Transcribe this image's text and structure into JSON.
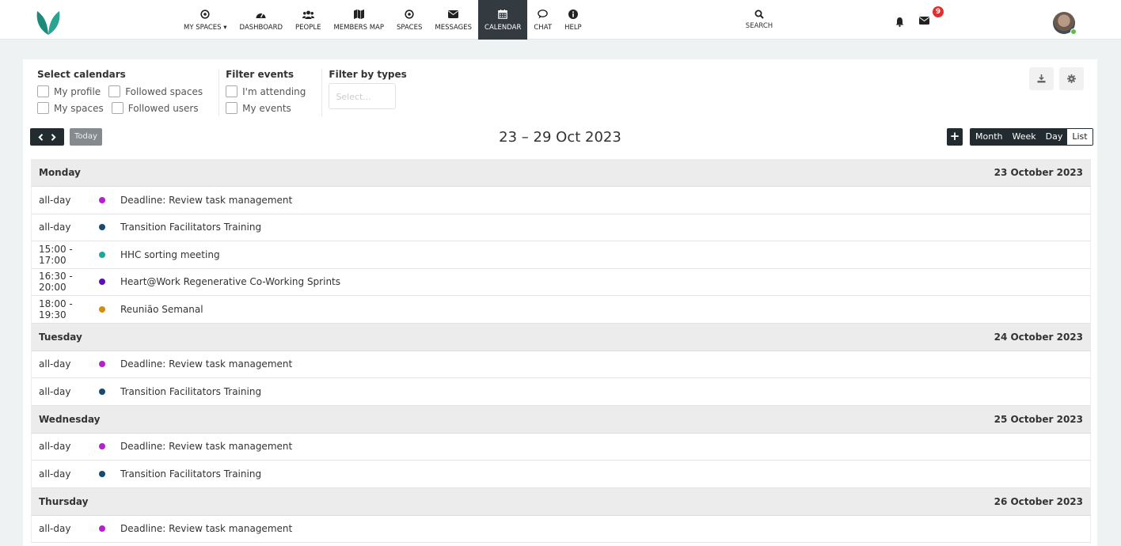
{
  "nav": {
    "items": [
      {
        "label": "MY SPACES ▾",
        "icon": "target-icon",
        "name": "nav-my-spaces"
      },
      {
        "label": "DASHBOARD",
        "icon": "dashboard-icon",
        "name": "nav-dashboard"
      },
      {
        "label": "PEOPLE",
        "icon": "people-icon",
        "name": "nav-people"
      },
      {
        "label": "MEMBERS MAP",
        "icon": "map-icon",
        "name": "nav-members-map"
      },
      {
        "label": "SPACES",
        "icon": "target-icon",
        "name": "nav-spaces"
      },
      {
        "label": "MESSAGES",
        "icon": "envelope-icon",
        "name": "nav-messages"
      },
      {
        "label": "CALENDAR",
        "icon": "calendar-icon",
        "name": "nav-calendar",
        "active": true
      },
      {
        "label": "CHAT",
        "icon": "chat-icon",
        "name": "nav-chat"
      },
      {
        "label": "HELP",
        "icon": "info-icon",
        "name": "nav-help"
      }
    ],
    "search_label": "SEARCH",
    "mail_badge": "9"
  },
  "filters": {
    "select_calendars_title": "Select calendars",
    "my_profile": "My profile",
    "followed_spaces": "Followed spaces",
    "my_spaces": "My spaces",
    "followed_users": "Followed users",
    "filter_events_title": "Filter events",
    "im_attending": "I'm attending",
    "my_events": "My events",
    "filter_types_title": "Filter by types",
    "types_placeholder": "Select..."
  },
  "toolbar": {
    "today_label": "Today",
    "period_title": "23 – 29 Oct 2023",
    "add_label": "+",
    "views": [
      "Month",
      "Week",
      "Day",
      "List"
    ],
    "active_view": "List"
  },
  "colors": {
    "magenta": "#b620cf",
    "navy": "#174a6e",
    "teal": "#1ba89c",
    "purple": "#5a0fb8",
    "amber": "#d38c0c"
  },
  "days": [
    {
      "day": "Monday",
      "date": "23 October 2023",
      "events": [
        {
          "time": "all-day",
          "color": "#b620cf",
          "title": "Deadline: Review task management"
        },
        {
          "time": "all-day",
          "color": "#174a6e",
          "title": "Transition Facilitators Training"
        },
        {
          "time": "15:00 - 17:00",
          "color": "#1ba89c",
          "title": "HHC sorting meeting"
        },
        {
          "time": "16:30 - 20:00",
          "color": "#5a0fb8",
          "title": "Heart@Work Regenerative Co-Working Sprints"
        },
        {
          "time": "18:00 - 19:30",
          "color": "#d38c0c",
          "title": "Reunião Semanal"
        }
      ]
    },
    {
      "day": "Tuesday",
      "date": "24 October 2023",
      "events": [
        {
          "time": "all-day",
          "color": "#b620cf",
          "title": "Deadline: Review task management"
        },
        {
          "time": "all-day",
          "color": "#174a6e",
          "title": "Transition Facilitators Training"
        }
      ]
    },
    {
      "day": "Wednesday",
      "date": "25 October 2023",
      "events": [
        {
          "time": "all-day",
          "color": "#b620cf",
          "title": "Deadline: Review task management"
        },
        {
          "time": "all-day",
          "color": "#174a6e",
          "title": "Transition Facilitators Training"
        }
      ]
    },
    {
      "day": "Thursday",
      "date": "26 October 2023",
      "events": [
        {
          "time": "all-day",
          "color": "#b620cf",
          "title": "Deadline: Review task management"
        }
      ]
    }
  ]
}
